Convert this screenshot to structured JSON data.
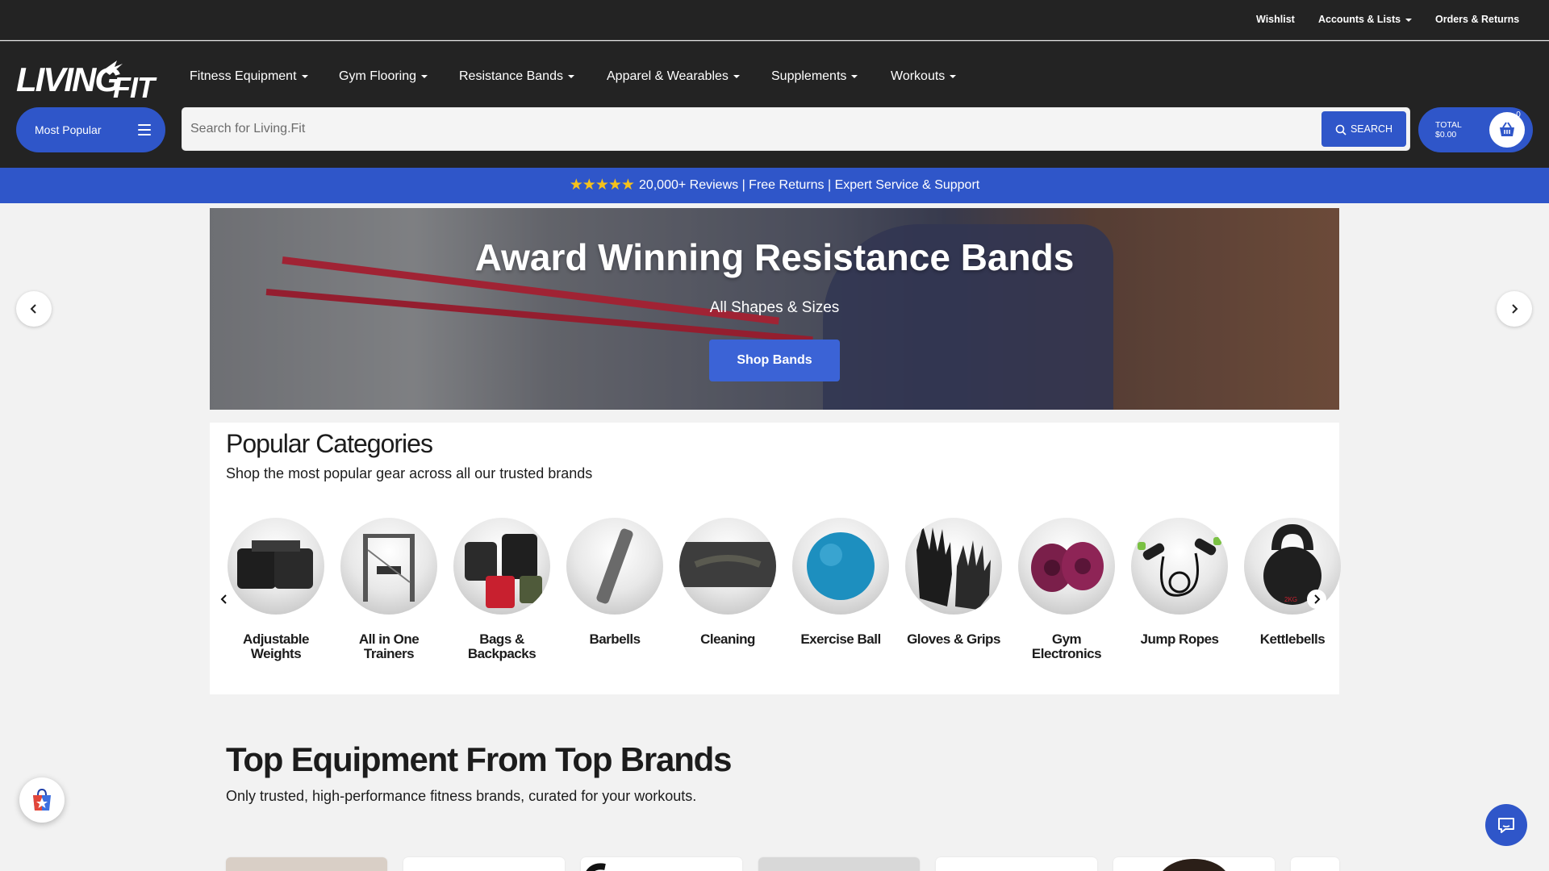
{
  "util": {
    "wishlist": "Wishlist",
    "accounts": "Accounts & Lists",
    "orders": "Orders & Returns"
  },
  "logo_text": "LIVING.FIT",
  "nav": [
    {
      "label": "Fitness Equipment"
    },
    {
      "label": "Gym Flooring"
    },
    {
      "label": "Resistance Bands"
    },
    {
      "label": "Apparel & Wearables"
    },
    {
      "label": "Supplements"
    },
    {
      "label": "Workouts"
    }
  ],
  "most_popular": "Most Popular",
  "search": {
    "placeholder": "Search for Living.Fit",
    "button": "SEARCH"
  },
  "cart": {
    "total_label": "TOTAL",
    "total_value": "$0.00",
    "count": "0"
  },
  "promo": {
    "stars": "★★★★★",
    "text": "20,000+ Reviews | Free Returns | Expert Service & Support"
  },
  "hero": {
    "title": "Award Winning Resistance Bands",
    "subtitle": "All Shapes & Sizes",
    "button": "Shop Bands"
  },
  "popular": {
    "title": "Popular Categories",
    "subtitle": "Shop the most popular gear across all our trusted brands",
    "categories": [
      {
        "name": "Adjustable Weights"
      },
      {
        "name": "All in One Trainers"
      },
      {
        "name": "Bags & Backpacks"
      },
      {
        "name": "Barbells"
      },
      {
        "name": "Cleaning"
      },
      {
        "name": "Exercise Ball"
      },
      {
        "name": "Gloves & Grips"
      },
      {
        "name": "Gym Electronics"
      },
      {
        "name": "Jump Ropes"
      },
      {
        "name": "Kettlebells"
      }
    ]
  },
  "brands": {
    "title": "Top Equipment From Top Brands",
    "subtitle": "Only trusted, high-performance fitness brands, curated for your workouts."
  },
  "colors": {
    "brand_blue": "#2f56c9",
    "dark": "#232323",
    "star": "#f5c11b"
  }
}
